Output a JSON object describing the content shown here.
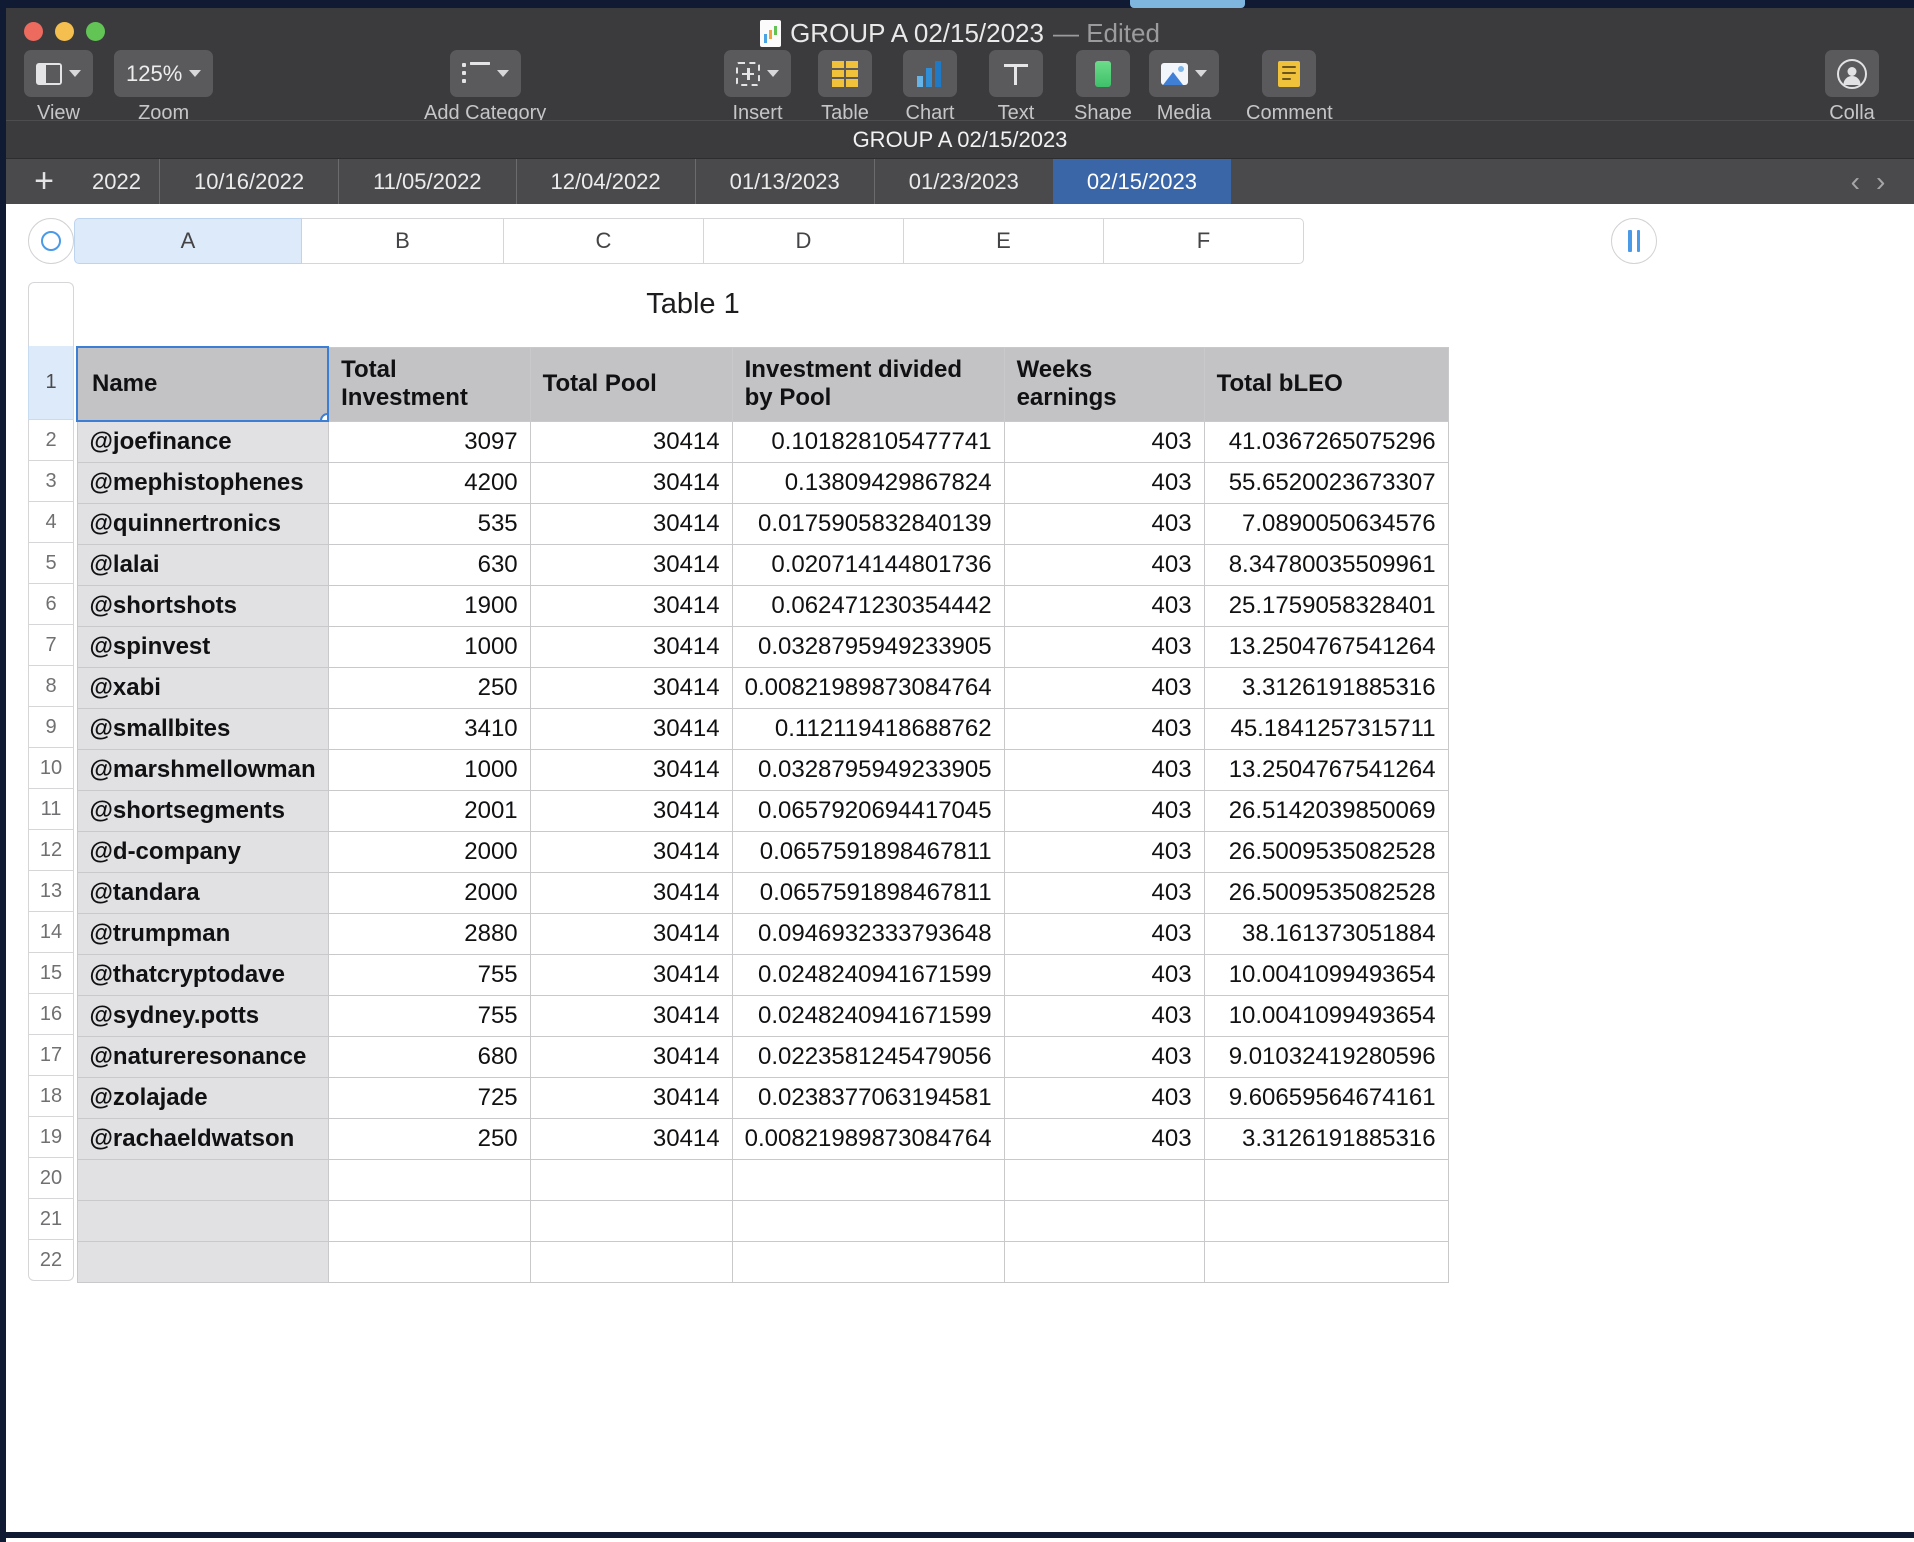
{
  "window": {
    "title": "GROUP A 02/15/2023",
    "edited_suffix": "— Edited",
    "app_icon": "numbers-document-icon"
  },
  "toolbar": {
    "items": [
      {
        "label": "View",
        "icon": "view-layout-icon",
        "has_chevron": true
      },
      {
        "label": "Zoom",
        "icon": "zoom-level",
        "value": "125%",
        "has_chevron": true
      },
      {
        "label": "Add Category",
        "icon": "category-list-icon",
        "has_chevron": true
      },
      {
        "label": "Insert",
        "icon": "insert-cell-icon",
        "has_chevron": true
      },
      {
        "label": "Table",
        "icon": "table-icon",
        "has_chevron": false
      },
      {
        "label": "Chart",
        "icon": "chart-bar-icon",
        "has_chevron": false
      },
      {
        "label": "Text",
        "icon": "text-icon",
        "has_chevron": false
      },
      {
        "label": "Shape",
        "icon": "shape-icon",
        "has_chevron": false
      },
      {
        "label": "Media",
        "icon": "media-image-icon",
        "has_chevron": true
      },
      {
        "label": "Comment",
        "icon": "comment-icon",
        "has_chevron": false
      },
      {
        "label": "Colla",
        "icon": "collaborate-icon",
        "has_chevron": false
      }
    ]
  },
  "sheet_name_bar": {
    "name": "GROUP A 02/15/2023"
  },
  "sheet_tabs": {
    "add_label": "+",
    "tabs": [
      {
        "label": "2022",
        "active": false,
        "clipped": true
      },
      {
        "label": "10/16/2022",
        "active": false
      },
      {
        "label": "11/05/2022",
        "active": false
      },
      {
        "label": "12/04/2022",
        "active": false
      },
      {
        "label": "01/13/2023",
        "active": false
      },
      {
        "label": "01/23/2023",
        "active": false
      },
      {
        "label": "02/15/2023",
        "active": true
      }
    ],
    "nav_prev": "‹",
    "nav_next": "›"
  },
  "grid": {
    "column_letters": [
      "A",
      "B",
      "C",
      "D",
      "E",
      "F"
    ],
    "selected_column": "A",
    "row_numbers": [
      "1",
      "2",
      "3",
      "4",
      "5",
      "6",
      "7",
      "8",
      "9",
      "10",
      "11",
      "12",
      "13",
      "14",
      "15",
      "16",
      "17",
      "18",
      "19",
      "20",
      "21",
      "22"
    ],
    "selected_row": "1",
    "select_all_icon": "select-all-circle-icon",
    "pause-icon": "pause-icon"
  },
  "table": {
    "title": "Table 1",
    "selected_cell": "A1",
    "headers": [
      "Name",
      "Total Investment",
      "Total Pool",
      "Investment divided by Pool",
      "Weeks earnings",
      "Total bLEO"
    ],
    "rows": [
      {
        "name": "@joefinance",
        "total_investment": "3097",
        "total_pool": "30414",
        "investment_divided_by_pool": "0.101828105477741",
        "weeks_earnings": "403",
        "total_bleo": "41.0367265075296"
      },
      {
        "name": "@mephistophenes",
        "total_investment": "4200",
        "total_pool": "30414",
        "investment_divided_by_pool": "0.13809429867824",
        "weeks_earnings": "403",
        "total_bleo": "55.6520023673307"
      },
      {
        "name": "@quinnertronics",
        "total_investment": "535",
        "total_pool": "30414",
        "investment_divided_by_pool": "0.0175905832840139",
        "weeks_earnings": "403",
        "total_bleo": "7.0890050634576"
      },
      {
        "name": "@lalai",
        "total_investment": "630",
        "total_pool": "30414",
        "investment_divided_by_pool": "0.020714144801736",
        "weeks_earnings": "403",
        "total_bleo": "8.34780035509961"
      },
      {
        "name": "@shortshots",
        "total_investment": "1900",
        "total_pool": "30414",
        "investment_divided_by_pool": "0.062471230354442",
        "weeks_earnings": "403",
        "total_bleo": "25.1759058328401"
      },
      {
        "name": "@spinvest",
        "total_investment": "1000",
        "total_pool": "30414",
        "investment_divided_by_pool": "0.0328795949233905",
        "weeks_earnings": "403",
        "total_bleo": "13.2504767541264"
      },
      {
        "name": "@xabi",
        "total_investment": "250",
        "total_pool": "30414",
        "investment_divided_by_pool": "0.00821989873084764",
        "weeks_earnings": "403",
        "total_bleo": "3.3126191885316"
      },
      {
        "name": "@smallbites",
        "total_investment": "3410",
        "total_pool": "30414",
        "investment_divided_by_pool": "0.112119418688762",
        "weeks_earnings": "403",
        "total_bleo": "45.1841257315711"
      },
      {
        "name": "@marshmellowman",
        "total_investment": "1000",
        "total_pool": "30414",
        "investment_divided_by_pool": "0.0328795949233905",
        "weeks_earnings": "403",
        "total_bleo": "13.2504767541264"
      },
      {
        "name": "@shortsegments",
        "total_investment": "2001",
        "total_pool": "30414",
        "investment_divided_by_pool": "0.0657920694417045",
        "weeks_earnings": "403",
        "total_bleo": "26.5142039850069"
      },
      {
        "name": "@d-company",
        "total_investment": "2000",
        "total_pool": "30414",
        "investment_divided_by_pool": "0.0657591898467811",
        "weeks_earnings": "403",
        "total_bleo": "26.5009535082528"
      },
      {
        "name": "@tandara",
        "total_investment": "2000",
        "total_pool": "30414",
        "investment_divided_by_pool": "0.0657591898467811",
        "weeks_earnings": "403",
        "total_bleo": "26.5009535082528"
      },
      {
        "name": "@trumpman",
        "total_investment": "2880",
        "total_pool": "30414",
        "investment_divided_by_pool": "0.0946932333793648",
        "weeks_earnings": "403",
        "total_bleo": "38.161373051884"
      },
      {
        "name": "@thatcryptodave",
        "total_investment": "755",
        "total_pool": "30414",
        "investment_divided_by_pool": "0.0248240941671599",
        "weeks_earnings": "403",
        "total_bleo": "10.0041099493654"
      },
      {
        "name": "@sydney.potts",
        "total_investment": "755",
        "total_pool": "30414",
        "investment_divided_by_pool": "0.0248240941671599",
        "weeks_earnings": "403",
        "total_bleo": "10.0041099493654"
      },
      {
        "name": "@natureresonance",
        "total_investment": "680",
        "total_pool": "30414",
        "investment_divided_by_pool": "0.0223581245479056",
        "weeks_earnings": "403",
        "total_bleo": "9.01032419280596"
      },
      {
        "name": "@zolajade",
        "total_investment": "725",
        "total_pool": "30414",
        "investment_divided_by_pool": "0.0238377063194581",
        "weeks_earnings": "403",
        "total_bleo": "9.60659564674161"
      },
      {
        "name": "@rachaeldwatson",
        "total_investment": "250",
        "total_pool": "30414",
        "investment_divided_by_pool": "0.00821989873084764",
        "weeks_earnings": "403",
        "total_bleo": "3.3126191885316"
      },
      {
        "name": "",
        "total_investment": "",
        "total_pool": "",
        "investment_divided_by_pool": "",
        "weeks_earnings": "",
        "total_bleo": ""
      },
      {
        "name": "",
        "total_investment": "",
        "total_pool": "",
        "investment_divided_by_pool": "",
        "weeks_earnings": "",
        "total_bleo": ""
      },
      {
        "name": "",
        "total_investment": "",
        "total_pool": "",
        "investment_divided_by_pool": "",
        "weeks_earnings": "",
        "total_bleo": ""
      }
    ]
  },
  "colors": {
    "accent_blue": "#3a66a8",
    "selection_blue": "#3a7fd5",
    "header_gray": "#c3c3c5",
    "name_col_gray": "#e1e1e3",
    "chrome_dark": "#3b3b3d"
  }
}
